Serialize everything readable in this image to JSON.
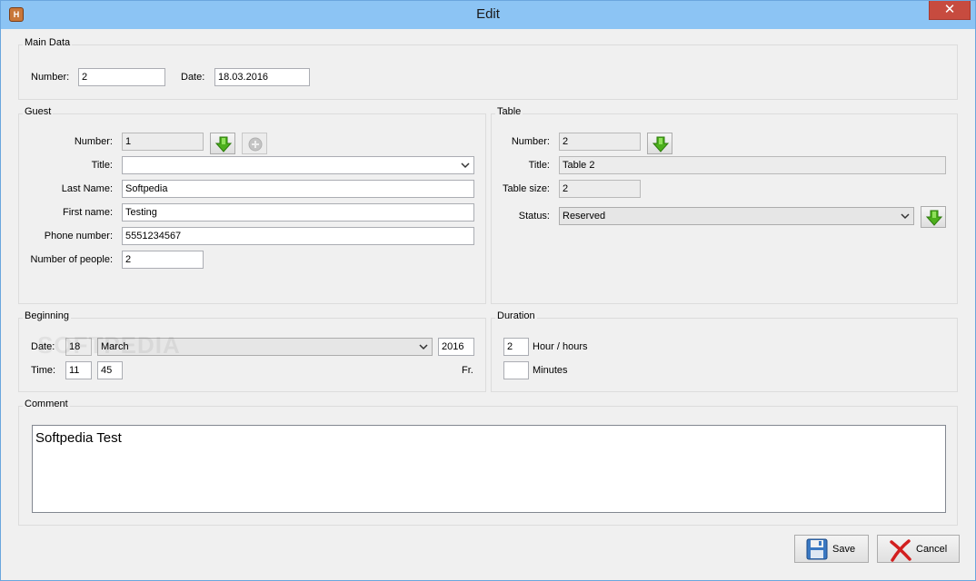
{
  "window": {
    "title": "Edit"
  },
  "main_data": {
    "title": "Main Data",
    "number_label": "Number:",
    "number_value": "2",
    "date_label": "Date:",
    "date_value": "18.03.2016"
  },
  "guest": {
    "title": "Guest",
    "number_label": "Number:",
    "number_value": "1",
    "title_label": "Title:",
    "title_value": "",
    "last_name_label": "Last Name:",
    "last_name_value": "Softpedia",
    "first_name_label": "First name:",
    "first_name_value": "Testing",
    "phone_label": "Phone number:",
    "phone_value": "5551234567",
    "people_label": "Number of people:",
    "people_value": "2"
  },
  "table": {
    "title": "Table",
    "number_label": "Number:",
    "number_value": "2",
    "title_label": "Title:",
    "title_value": "Table 2",
    "size_label": "Table size:",
    "size_value": "2",
    "status_label": "Status:",
    "status_value": "Reserved"
  },
  "beginning": {
    "title": "Beginning",
    "date_label": "Date:",
    "day": "18",
    "month": "March",
    "year": "2016",
    "time_label": "Time:",
    "hour": "11",
    "minute": "45",
    "weekday": "Fr."
  },
  "duration": {
    "title": "Duration",
    "hours_value": "2",
    "hours_label": "Hour / hours",
    "minutes_value": "",
    "minutes_label": "Minutes"
  },
  "comment": {
    "title": "Comment",
    "text": "Softpedia Test"
  },
  "buttons": {
    "save_label": "Save",
    "cancel_label": "Cancel"
  },
  "watermark": "SOFTPEDIA",
  "colors": {
    "titlebar": "#8cc4f4",
    "close": "#c74b3f",
    "arrow_green": "#4caf1c"
  }
}
